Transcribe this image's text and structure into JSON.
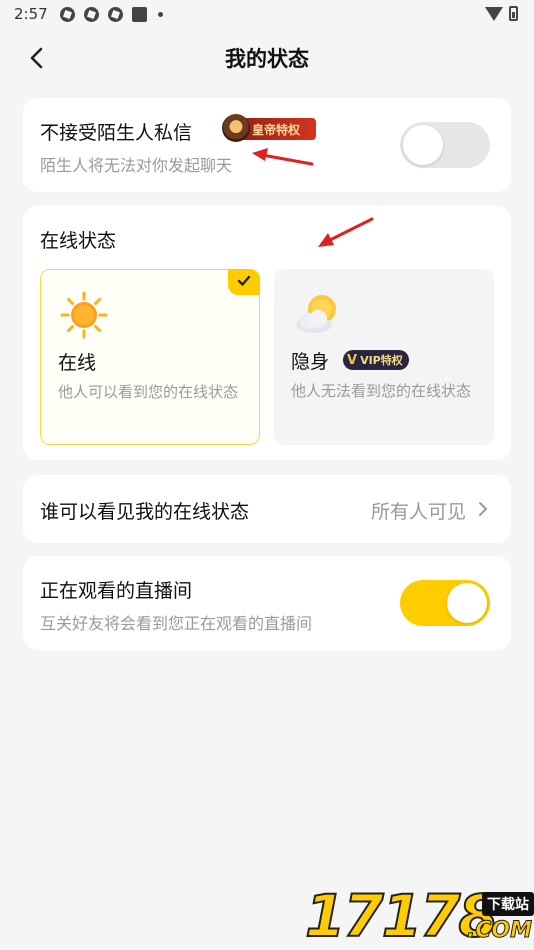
{
  "status_bar": {
    "time": "2:57"
  },
  "header": {
    "title": "我的状态"
  },
  "stranger_dm": {
    "title": "不接受陌生人私信",
    "badge": "皇帝特权",
    "subtitle": "陌生人将无法对你发起聊天",
    "enabled": false
  },
  "online_status": {
    "title": "在线状态",
    "options": [
      {
        "label": "在线",
        "desc": "他人可以看到您的在线状态",
        "selected": true,
        "icon": "sun-icon"
      },
      {
        "label": "隐身",
        "desc": "他人无法看到您的在线状态",
        "selected": false,
        "badge": "VIP特权",
        "icon": "cloud-sun-icon"
      }
    ]
  },
  "visibility": {
    "title": "谁可以看见我的在线状态",
    "value": "所有人可见"
  },
  "watching_live": {
    "title": "正在观看的直播间",
    "subtitle": "互关好友将会看到您正在观看的直播间",
    "enabled": true
  },
  "watermark": {
    "digits": "17178",
    "tag": "下载站",
    "suffix": ".COM"
  },
  "colors": {
    "accent": "#ffcc00",
    "background": "#f5f5f5",
    "muted_text": "#9a9a9a"
  }
}
